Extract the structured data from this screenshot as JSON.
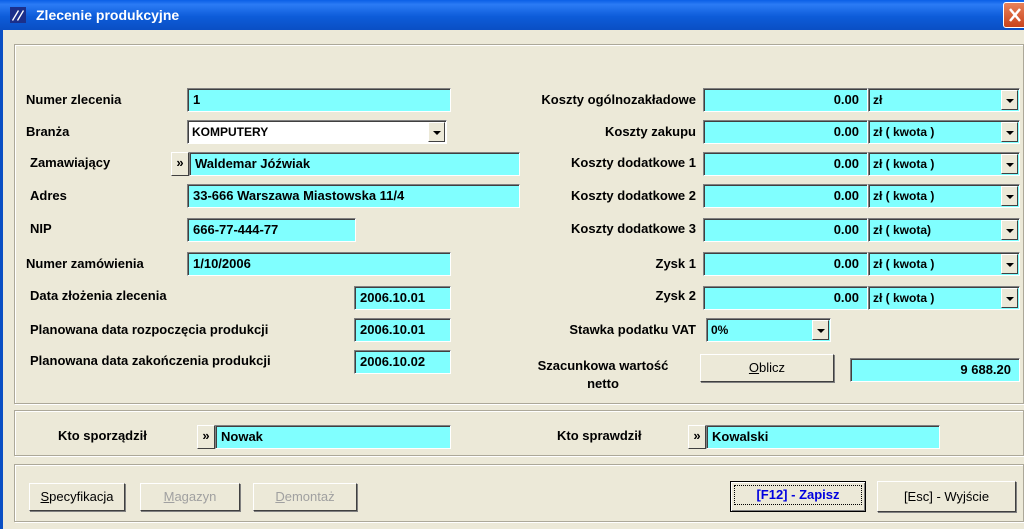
{
  "window": {
    "title": "Zlecenie produkcyjne"
  },
  "left": {
    "order_number_label": "Numer zlecenia",
    "order_number": "1",
    "industry_label": "Branża",
    "industry": "KOMPUTERY",
    "client_label": "Zamawiający",
    "picker_glyph": "»",
    "client": "Waldemar Jóźwiak",
    "address_label": "Adres",
    "address": "33-666 Warszawa Miastowska 11/4",
    "nip_label": "NIP",
    "nip": "666-77-444-77",
    "order_ref_label": "Numer zamówienia",
    "order_ref": "1/10/2006",
    "submit_date_label": "Data złożenia zlecenia",
    "submit_date": "2006.10.01",
    "start_date_label": "Planowana data rozpoczęcia produkcji",
    "start_date": "2006.10.01",
    "end_date_label": "Planowana data zakończenia produkcji",
    "end_date": "2006.10.02"
  },
  "right": {
    "costs": [
      {
        "label": "Koszty ogólnozakładowe",
        "value": "0.00",
        "unit": "zł"
      },
      {
        "label": "Koszty zakupu",
        "value": "0.00",
        "unit": "zł ( kwota )"
      },
      {
        "label": "Koszty dodatkowe 1",
        "value": "0.00",
        "unit": "zł ( kwota )"
      },
      {
        "label": "Koszty dodatkowe 2",
        "value": "0.00",
        "unit": "zł ( kwota )"
      },
      {
        "label": "Koszty dodatkowe 3",
        "value": "0.00",
        "unit": "zł ( kwota)"
      },
      {
        "label": "Zysk 1",
        "value": "0.00",
        "unit": "zł ( kwota )"
      },
      {
        "label": "Zysk 2",
        "value": "0.00",
        "unit": "zł ( kwota )"
      }
    ],
    "vat_label": "Stawka podatku VAT",
    "vat": "0%",
    "estimate_label_1": "Szacunkowa wartość",
    "estimate_label_2": "netto",
    "calculate_button": "Oblicz",
    "estimate_value": "9 688.20"
  },
  "people": {
    "prepared_label": "Kto sporządził",
    "prepared_by": "Nowak",
    "checked_label": "Kto sprawdził",
    "checked_by": "Kowalski"
  },
  "buttons": {
    "spec": "Specyfikacja",
    "warehouse": "Magazyn",
    "disassembly": "Demontaż",
    "save": "[F12] - Zapisz",
    "exit": "[Esc] - Wyjście"
  },
  "colors": {
    "field": "#80FFFF",
    "titlebar": "#0A5FE6",
    "background": "#ECE9D8"
  }
}
